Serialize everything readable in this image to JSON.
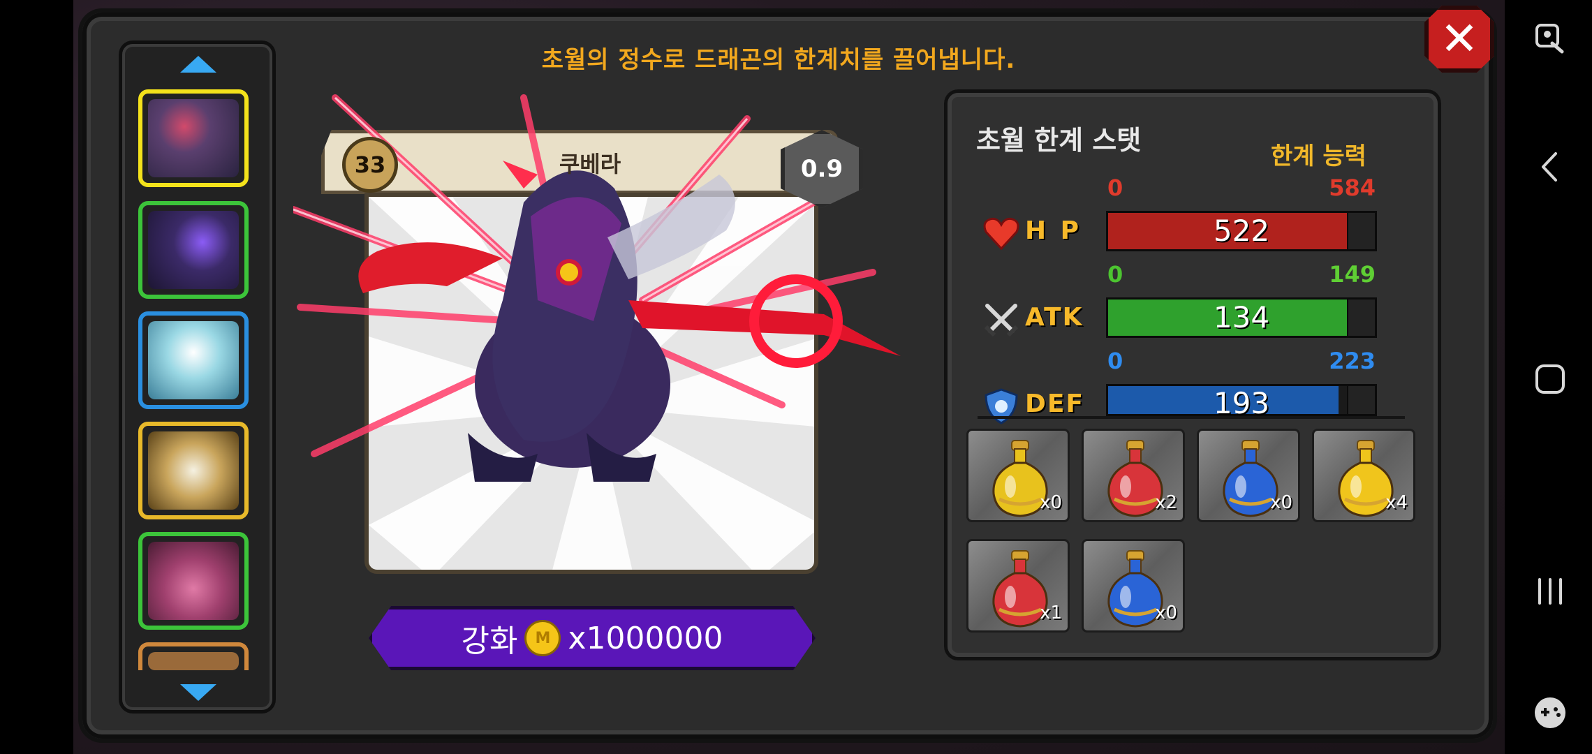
{
  "title": "초월의 정수로 드래곤의 한계치를 끌어냅니다.",
  "close_icon": "close-icon",
  "dragon": {
    "level": "33",
    "name": "쿠베라",
    "grade": "0.9"
  },
  "enhance": {
    "label": "강화",
    "cost": "x1000000"
  },
  "stats": {
    "title": "초월 한계 스탯",
    "subtitle": "한계 능력",
    "rows": [
      {
        "label": "H P",
        "min": "0",
        "max": "584",
        "value": "522",
        "fill": 0.894,
        "color": "#b0221d",
        "max_color": "#e03b2c",
        "icon": "heart-icon"
      },
      {
        "label": "ATK",
        "min": "0",
        "max": "149",
        "value": "134",
        "fill": 0.899,
        "color": "#2fa12d",
        "max_color": "#5fcf34",
        "icon": "swords-icon"
      },
      {
        "label": "DEF",
        "min": "0",
        "max": "223",
        "value": "193",
        "fill": 0.865,
        "color": "#1c5aab",
        "max_color": "#2f8cf0",
        "icon": "shield-icon"
      }
    ]
  },
  "potions": [
    {
      "count": "x0",
      "color": "#e8c21d",
      "icon": "yellow-potion-icon"
    },
    {
      "count": "x2",
      "color": "#d8343a",
      "icon": "red-potion-icon"
    },
    {
      "count": "x0",
      "color": "#2a64d6",
      "icon": "blue-potion-icon"
    },
    {
      "count": "x4",
      "color": "#f0c51c",
      "icon": "large-yellow-potion-icon"
    },
    {
      "count": "x1",
      "color": "#d8343a",
      "icon": "large-red-potion-icon"
    },
    {
      "count": "x0",
      "color": "#2a64d6",
      "icon": "large-blue-potion-icon"
    }
  ],
  "dragon_list": [
    {
      "name": "selected-dragon-thumb",
      "border": "#f4e21b",
      "art": "#5a3f6e"
    },
    {
      "name": "purple-dragon-thumb",
      "border": "#3cc43a",
      "art": "#3b2a68"
    },
    {
      "name": "ice-dragon-thumb",
      "border": "#2a8fe0",
      "art": "#7dc6d6"
    },
    {
      "name": "golden-dragon-thumb",
      "border": "#e8b92a",
      "art": "#c9a55c"
    },
    {
      "name": "pink-dragon-thumb",
      "border": "#3cc43a",
      "art": "#a0406e"
    },
    {
      "name": "bronze-dragon-thumb",
      "border": "#d0883c",
      "art": "#9a6a3a"
    }
  ]
}
